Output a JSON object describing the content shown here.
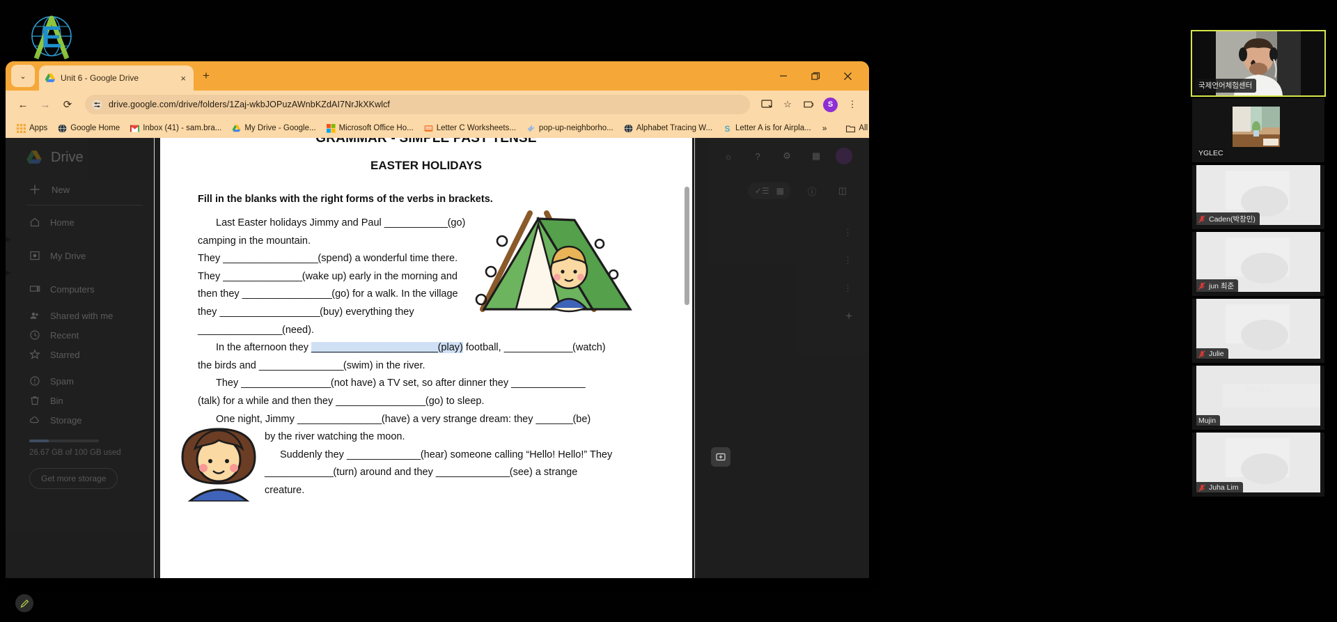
{
  "browser": {
    "tab": {
      "title": "Unit 6 - Google Drive",
      "favicon": "google-drive-icon",
      "close": "×"
    },
    "new_tab_label": "+",
    "tab_search_chevron": "⌄",
    "window_controls": {
      "minimize": "—",
      "maximize": "❐",
      "close": "✕"
    },
    "nav": {
      "back": "←",
      "forward": "→",
      "reload": "⟳"
    },
    "omnibox": {
      "url": "drive.google.com/drive/folders/1Zaj-wkbJOPuzAWnbKZdAI7NrJkXKwlcf",
      "site_settings_icon": "tune-icon",
      "cast_icon": "cast-icon",
      "star_icon": "☆"
    },
    "toolbar_right": {
      "extensions_icon": "extensions-icon",
      "profile_initial": "S",
      "menu_icon": "⋮"
    },
    "bookmarks": [
      {
        "label": "Apps",
        "icon": "apps-grid-icon"
      },
      {
        "label": "Google Home",
        "icon": "globe-icon"
      },
      {
        "label": "Inbox (41) - sam.bra...",
        "icon": "gmail-icon"
      },
      {
        "label": "My Drive - Google...",
        "icon": "google-drive-icon"
      },
      {
        "label": "Microsoft Office Ho...",
        "icon": "microsoft-icon"
      },
      {
        "label": "Letter C Worksheets...",
        "icon": "orange-doc-icon"
      },
      {
        "label": "pop-up-neighborho...",
        "icon": "tag-icon"
      },
      {
        "label": "Alphabet Tracing W...",
        "icon": "globe-icon"
      },
      {
        "label": "Letter A is for Airpla...",
        "icon": "s-icon"
      }
    ],
    "bookmarks_overflow": "»",
    "all_bookmarks": {
      "label": "All Bookmarks",
      "icon": "folder-icon"
    }
  },
  "drive": {
    "brand": "Drive",
    "new_button": "New",
    "nav_items": [
      {
        "label": "Home",
        "icon": "home-icon",
        "expandable": false
      },
      {
        "label": "My Drive",
        "icon": "my-drive-icon",
        "expandable": true
      },
      {
        "label": "Computers",
        "icon": "computer-icon",
        "expandable": true
      }
    ],
    "nav_items2": [
      {
        "label": "Shared with me",
        "icon": "people-icon"
      },
      {
        "label": "Recent",
        "icon": "clock-icon"
      },
      {
        "label": "Starred",
        "icon": "star-icon"
      }
    ],
    "nav_items3": [
      {
        "label": "Spam",
        "icon": "spam-icon"
      },
      {
        "label": "Bin",
        "icon": "trash-icon"
      },
      {
        "label": "Storage",
        "icon": "cloud-icon"
      }
    ],
    "storage_text": "26.67 GB of 100 GB used",
    "storage_button": "Get more storage",
    "top_icons": [
      "support-icon",
      "help-icon",
      "settings-icon",
      "apps-grid-icon",
      "account-avatar"
    ],
    "view_icons": [
      "checklist-icon",
      "list-view-icon",
      "grid-view-icon",
      "info-icon",
      "side-panel-icon"
    ],
    "row_menu_icon": "⋮",
    "add_icon": "+"
  },
  "document": {
    "header": "GRAMMAR - SIMPLE PAST TENSE",
    "title": "EASTER HOLIDAYS",
    "instruction": "Fill in the blanks with the right forms of the verbs in brackets.",
    "lines": [
      {
        "indent": "para",
        "parts": [
          {
            "t": "Last Easter holidays Jimmy and Paul "
          },
          {
            "t": "____________",
            "blank": true
          },
          {
            "t": "(go)"
          }
        ]
      },
      {
        "indent": "none",
        "parts": [
          {
            "t": "camping in the mountain."
          }
        ]
      },
      {
        "indent": "none",
        "parts": [
          {
            "t": "They "
          },
          {
            "t": "__________________",
            "blank": true
          },
          {
            "t": "(spend) a wonderful time there."
          }
        ]
      },
      {
        "indent": "none",
        "parts": [
          {
            "t": "They "
          },
          {
            "t": "_______________",
            "blank": true
          },
          {
            "t": "(wake up)  early in the morning and"
          }
        ]
      },
      {
        "indent": "none",
        "parts": [
          {
            "t": "then they "
          },
          {
            "t": "_________________",
            "blank": true
          },
          {
            "t": "(go) for a walk. In the village"
          }
        ]
      },
      {
        "indent": "none",
        "parts": [
          {
            "t": "they "
          },
          {
            "t": "___________________",
            "blank": true
          },
          {
            "t": "(buy) everything they"
          }
        ]
      },
      {
        "indent": "none",
        "parts": [
          {
            "t": "________________",
            "blank": true
          },
          {
            "t": "(need)."
          }
        ]
      },
      {
        "indent": "para",
        "parts": [
          {
            "t": "In the afternoon they "
          },
          {
            "t": "________________________",
            "blank": true,
            "selected": true
          },
          {
            "t": "(play)",
            "selected": true
          },
          {
            "t": " football, "
          },
          {
            "t": "_____________",
            "blank": true
          },
          {
            "t": "(watch)"
          }
        ]
      },
      {
        "indent": "none",
        "parts": [
          {
            "t": "the birds and "
          },
          {
            "t": "________________",
            "blank": true
          },
          {
            "t": "(swim) in the river."
          }
        ]
      },
      {
        "indent": "para",
        "parts": [
          {
            "t": "They "
          },
          {
            "t": "_________________",
            "blank": true
          },
          {
            "t": "(not have) a TV set, so after dinner they "
          },
          {
            "t": "______________",
            "blank": true
          }
        ]
      },
      {
        "indent": "none",
        "parts": [
          {
            "t": "(talk) for a while and then they "
          },
          {
            "t": "_________________",
            "blank": true
          },
          {
            "t": "(go) to sleep."
          }
        ]
      },
      {
        "indent": "para",
        "parts": [
          {
            "t": "One night, Jimmy "
          },
          {
            "t": "________________",
            "blank": true
          },
          {
            "t": "(have)  a very strange dream: they "
          },
          {
            "t": "_______",
            "blank": true
          },
          {
            "t": "(be)"
          }
        ]
      },
      {
        "indent": "mid",
        "parts": [
          {
            "t": "by the river watching the moon."
          }
        ]
      },
      {
        "indent": "wide",
        "parts": [
          {
            "t": "Suddenly they "
          },
          {
            "t": "______________",
            "blank": true
          },
          {
            "t": "(hear) someone calling “Hello! Hello!” They"
          }
        ]
      },
      {
        "indent": "mid",
        "parts": [
          {
            "t": "_____________",
            "blank": true
          },
          {
            "t": "(turn) around and they "
          },
          {
            "t": "______________",
            "blank": true
          },
          {
            "t": "(see) a strange"
          }
        ]
      },
      {
        "indent": "mid",
        "parts": [
          {
            "t": "creature."
          }
        ]
      }
    ]
  },
  "video_rail": [
    {
      "name": "국제언어체험센터",
      "active_speaker": true,
      "muted": false,
      "kind": "webcam-person"
    },
    {
      "name": "YGLEC",
      "active_speaker": false,
      "muted": false,
      "kind": "room-photo"
    },
    {
      "name": "Caden(박창민)",
      "active_speaker": false,
      "muted": true,
      "kind": "bright-room"
    },
    {
      "name": "jun 최준",
      "active_speaker": false,
      "muted": true,
      "kind": "bright-room"
    },
    {
      "name": "Julie",
      "active_speaker": false,
      "muted": true,
      "kind": "bright-room"
    },
    {
      "name": "Mujin",
      "active_speaker": false,
      "muted": false,
      "kind": "name-placeholder"
    },
    {
      "name": "Juha Lim",
      "active_speaker": false,
      "muted": true,
      "kind": "bright-room"
    }
  ],
  "annotate_button": {
    "icon": "pen-icon"
  }
}
